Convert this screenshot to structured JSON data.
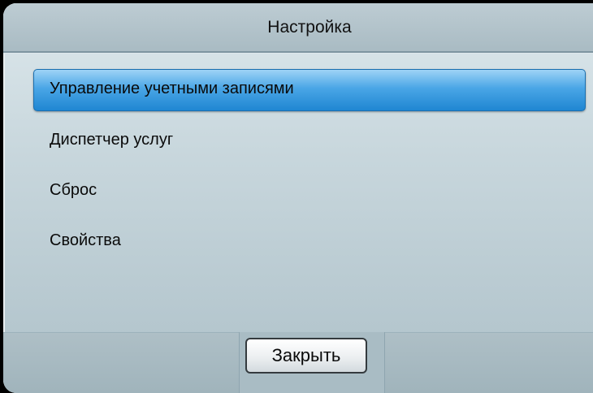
{
  "dialog": {
    "title": "Настройка"
  },
  "menu": {
    "selected_index": 0,
    "items": [
      {
        "label": "Управление учетными записями"
      },
      {
        "label": "Диспетчер услуг"
      },
      {
        "label": "Сброс"
      },
      {
        "label": "Свойства"
      }
    ]
  },
  "footer": {
    "close_label": "Закрыть"
  },
  "colors": {
    "highlight": "#3a9be0",
    "panel": "#c7d6dc",
    "text": "#0a0a0a"
  }
}
